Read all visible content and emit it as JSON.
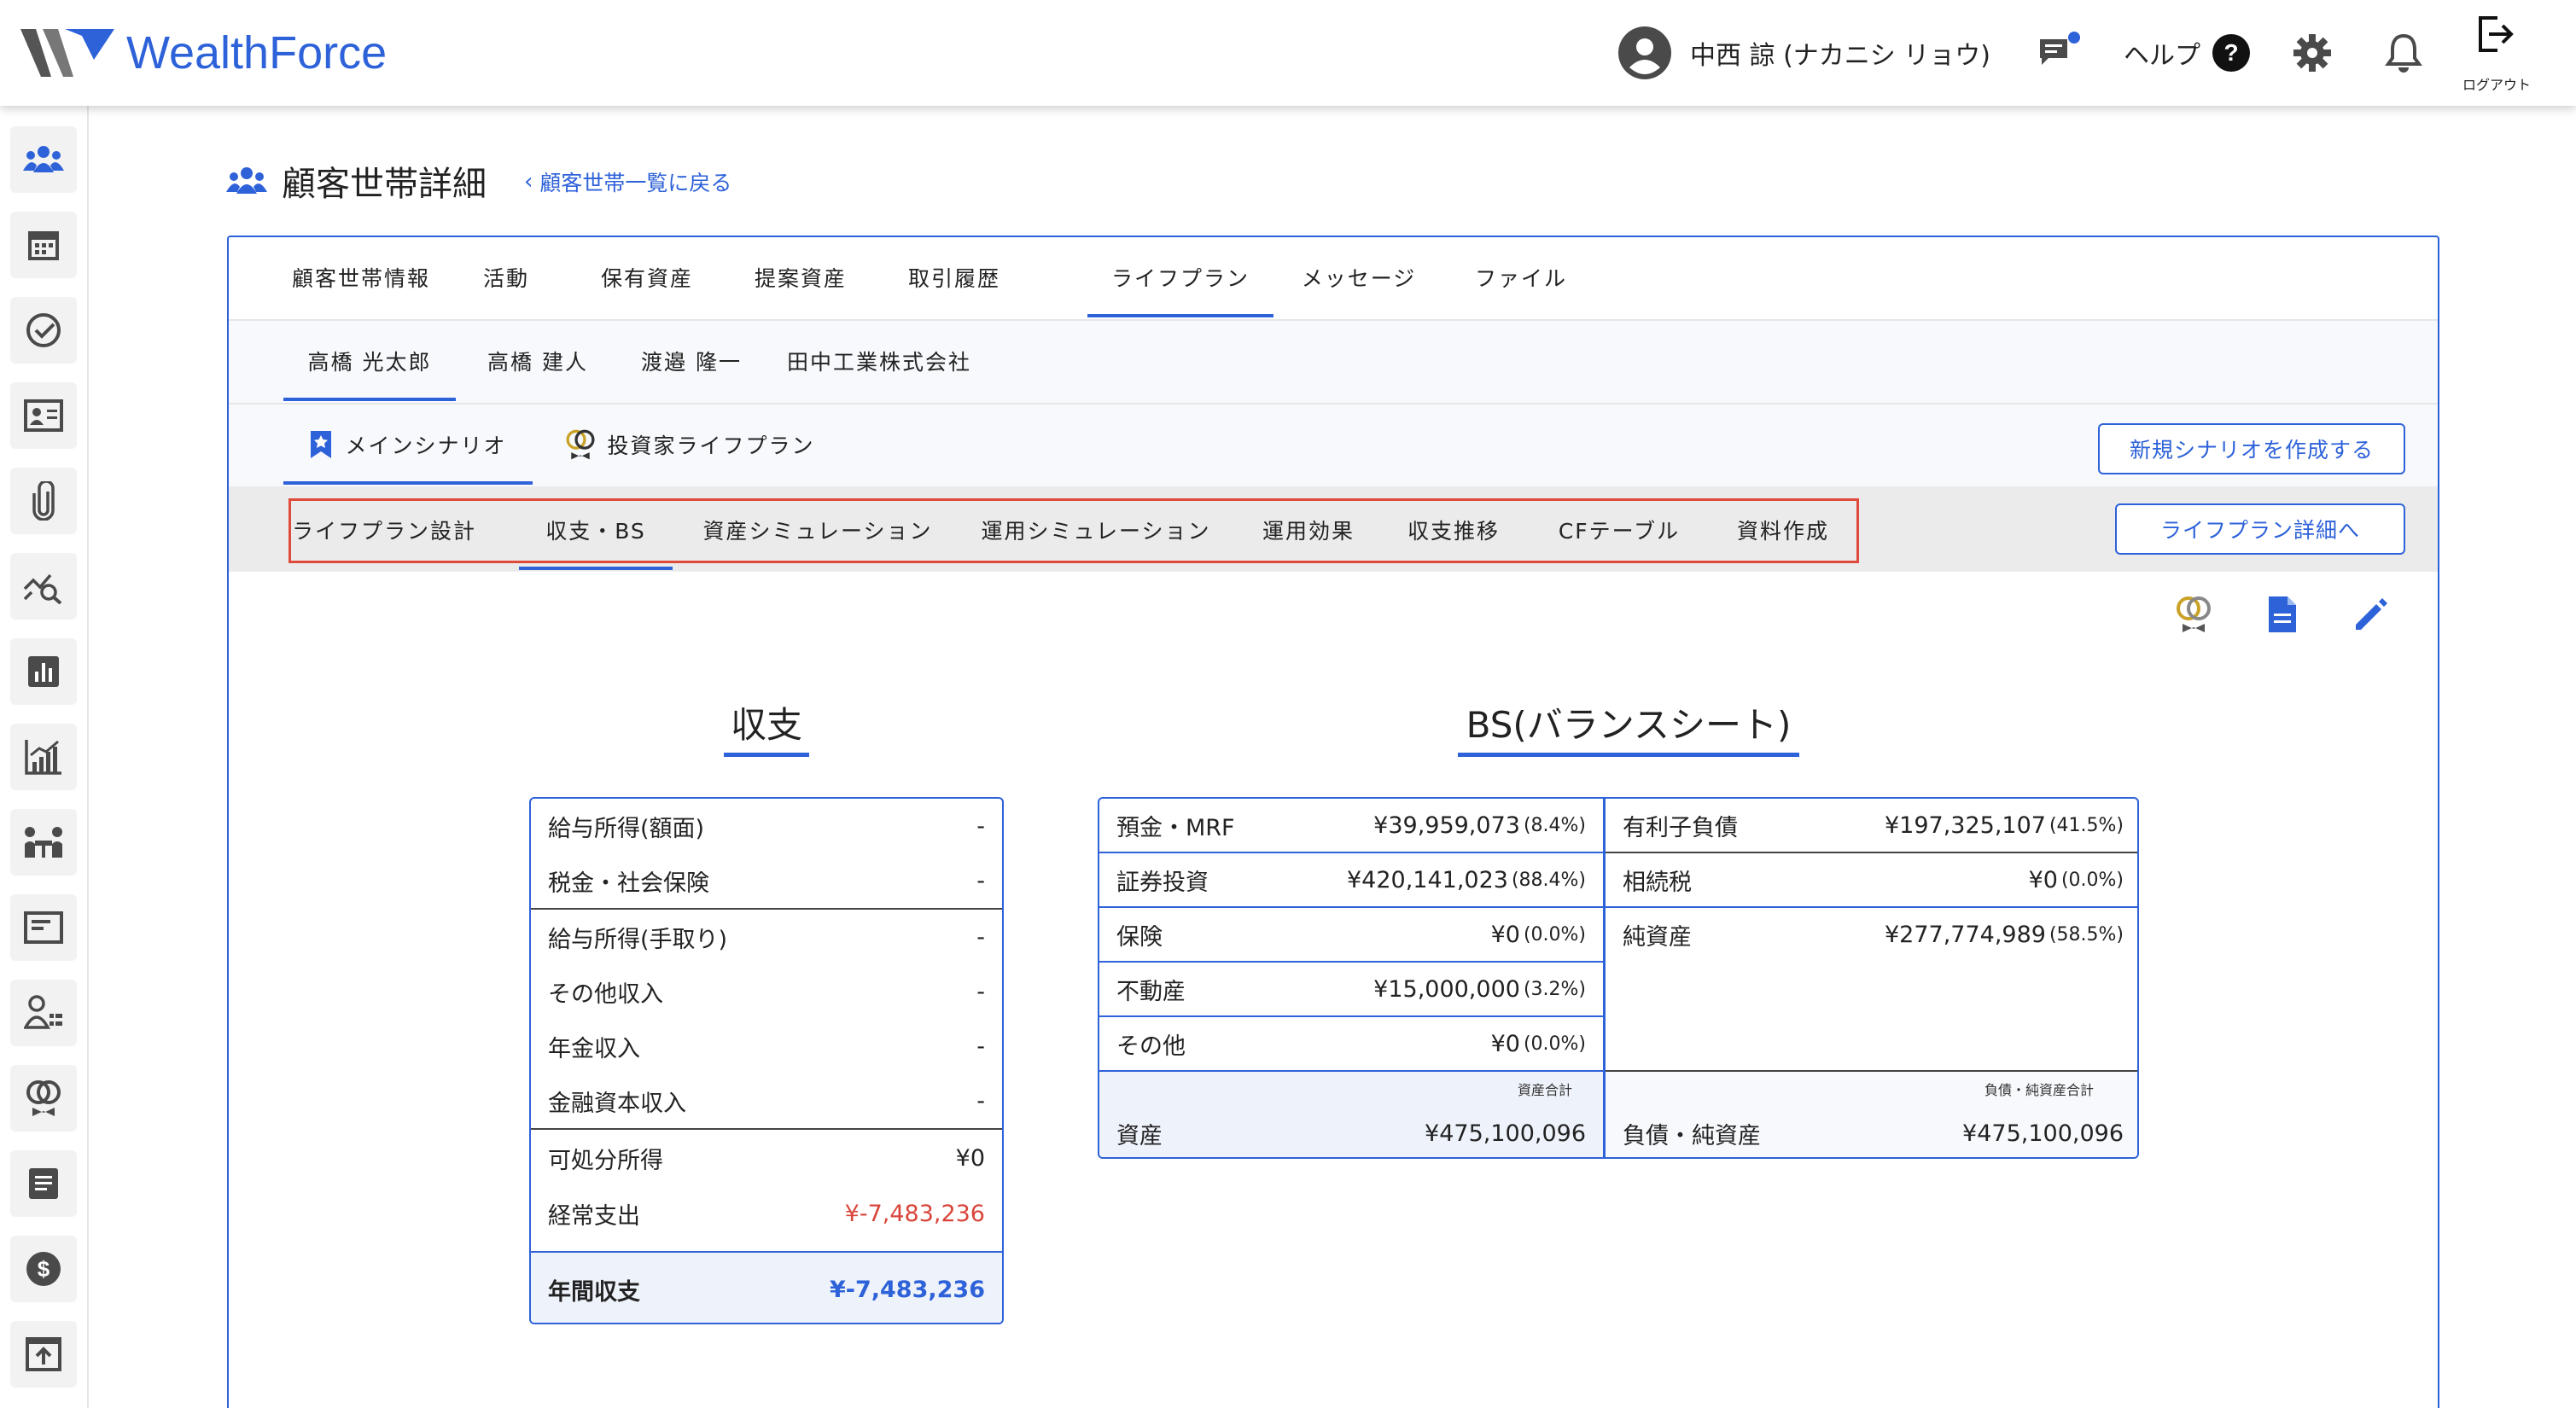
{
  "app": {
    "logo_text_1": "Wealth",
    "logo_text_2": "Force",
    "brand_color": "#2e62d9",
    "user_name": "中西 諒 (ナカニシ リョウ)",
    "help_label": "ヘルプ",
    "logout_label": "ログアウト"
  },
  "sidebar": {
    "items": [
      {
        "icon": "people-icon",
        "active": true
      },
      {
        "icon": "calendar-icon"
      },
      {
        "icon": "check-circle-icon"
      },
      {
        "icon": "id-card-icon"
      },
      {
        "icon": "paperclip-icon"
      },
      {
        "icon": "trend-search-icon"
      },
      {
        "icon": "bar-chart-icon"
      },
      {
        "icon": "growth-chart-icon"
      },
      {
        "icon": "meeting-icon"
      },
      {
        "icon": "window-icon"
      },
      {
        "icon": "user-list-icon"
      },
      {
        "icon": "rings-icon"
      },
      {
        "icon": "document-icon"
      },
      {
        "icon": "dollar-icon"
      },
      {
        "icon": "upload-icon"
      }
    ]
  },
  "page": {
    "title": "顧客世帯詳細",
    "back_link": "顧客世帯一覧に戻る"
  },
  "tabs_main": [
    "顧客世帯情報",
    "活動",
    "保有資産",
    "提案資産",
    "取引履歴",
    "ライフプラン",
    "メッセージ",
    "ファイル"
  ],
  "tabs_main_active": "ライフプラン",
  "tabs_members": [
    "高橋 光太郎",
    "高橋 建人",
    "渡邉 隆一",
    "田中工業株式会社"
  ],
  "tabs_members_active": "高橋 光太郎",
  "scenario_tabs": [
    "メインシナリオ",
    "投資家ライフプラン"
  ],
  "new_scenario_button": "新規シナリオを作成する",
  "sub_tabs": [
    "ライフプラン設計",
    "収支・BS",
    "資産シミュレーション",
    "運用シミュレーション",
    "運用効果",
    "収支推移",
    "CFテーブル",
    "資料作成"
  ],
  "sub_tabs_active": "収支・BS",
  "lifeplan_detail_button": "ライフプラン詳細へ",
  "income": {
    "title": "収支",
    "rows": [
      {
        "label": "給与所得(額面)",
        "value": "-"
      },
      {
        "label": "税金・社会保険",
        "value": "-"
      },
      {
        "label": "給与所得(手取り)",
        "value": "-"
      },
      {
        "label": "その他収入",
        "value": "-"
      },
      {
        "label": "年金収入",
        "value": "-"
      },
      {
        "label": "金融資本収入",
        "value": "-"
      },
      {
        "label": "可処分所得",
        "value": "¥0"
      },
      {
        "label": "経常支出",
        "value": "¥-7,483,236"
      },
      {
        "label": "年間収支",
        "value": "¥-7,483,236"
      }
    ]
  },
  "bs": {
    "title": "BS(バランスシート)",
    "assets": [
      {
        "label": "預金・MRF",
        "value": "¥39,959,073",
        "pct": "(8.4%)"
      },
      {
        "label": "証券投資",
        "value": "¥420,141,023",
        "pct": "(88.4%)"
      },
      {
        "label": "保険",
        "value": "¥0",
        "pct": "(0.0%)"
      },
      {
        "label": "不動産",
        "value": "¥15,000,000",
        "pct": "(3.2%)"
      },
      {
        "label": "その他",
        "value": "¥0",
        "pct": "(0.0%)"
      }
    ],
    "liabilities": [
      {
        "label": "有利子負債",
        "value": "¥197,325,107",
        "pct": "(41.5%)"
      },
      {
        "label": "相続税",
        "value": "¥0",
        "pct": "(0.0%)"
      },
      {
        "label": "純資産",
        "value": "¥277,774,989",
        "pct": "(58.5%)"
      }
    ],
    "assets_total_caption": "資産合計",
    "assets_total_label": "資産",
    "assets_total_value": "¥475,100,096",
    "liab_total_caption": "負債・純資産合計",
    "liab_total_label": "負債・純資産",
    "liab_total_value": "¥475,100,096"
  }
}
